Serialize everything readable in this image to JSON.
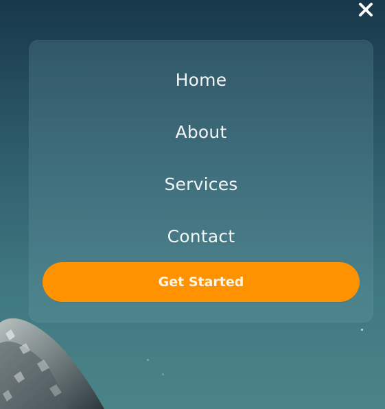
{
  "menu": {
    "items": [
      {
        "label": "Home"
      },
      {
        "label": "About"
      },
      {
        "label": "Services"
      },
      {
        "label": "Contact"
      }
    ],
    "cta_label": "Get Started"
  },
  "icons": {
    "close": "close-icon"
  },
  "colors": {
    "background_top": "#17384a",
    "background_bottom": "#4a8488",
    "accent": "#ff9200",
    "menu_text": "#f2f6f7"
  }
}
